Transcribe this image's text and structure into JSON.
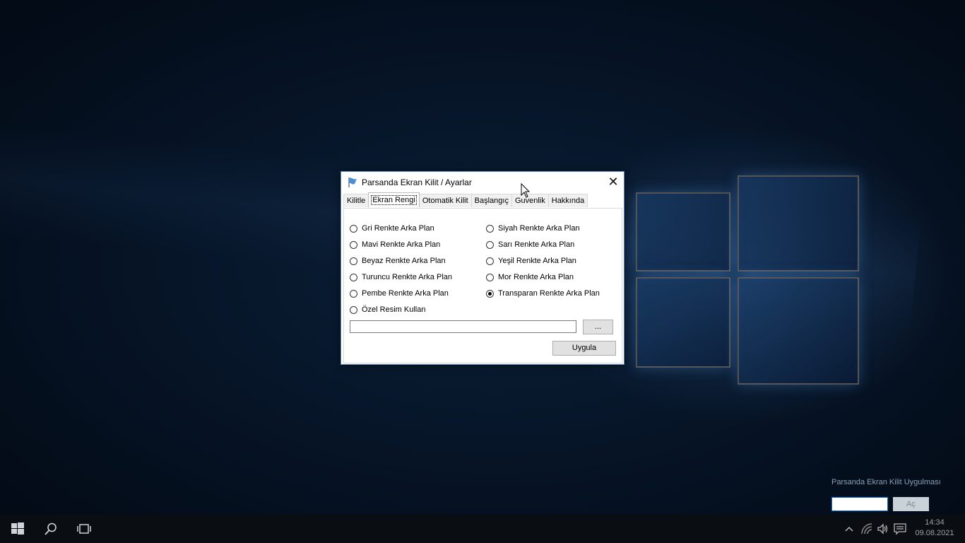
{
  "dialog": {
    "title": "Parsanda Ekran Kilit / Ayarlar",
    "close_symbol": "✕",
    "tabs": [
      {
        "label": "Kilitle"
      },
      {
        "label": "Ekran Rengi"
      },
      {
        "label": "Otomatik Kilit"
      },
      {
        "label": "Başlangıç"
      },
      {
        "label": "Guvenlik"
      },
      {
        "label": "Hakkında"
      }
    ],
    "active_tab": "Ekran Rengi",
    "options_left": [
      {
        "label": "Gri Renkte Arka Plan",
        "checked": false
      },
      {
        "label": "Mavi Renkte Arka Plan",
        "checked": false
      },
      {
        "label": "Beyaz Renkte Arka Plan",
        "checked": false
      },
      {
        "label": "Turuncu Renkte Arka Plan",
        "checked": false
      },
      {
        "label": "Pembe Renkte Arka Plan",
        "checked": false
      },
      {
        "label": "Özel Resim Kullan",
        "checked": false
      }
    ],
    "options_right": [
      {
        "label": "Siyah Renkte Arka Plan",
        "checked": false
      },
      {
        "label": "Sarı Renkte Arka Plan",
        "checked": false
      },
      {
        "label": "Yeşil Renkte Arka Plan",
        "checked": false
      },
      {
        "label": "Mor Renkte Arka Plan",
        "checked": false
      },
      {
        "label": "Transparan Renkte Arka Plan",
        "checked": true
      }
    ],
    "image_path": "",
    "browse_label": "...",
    "apply_label": "Uygula"
  },
  "lock_widget": {
    "label": "Parsanda Ekran Kilit Uygulması",
    "password_value": "",
    "open_label": "Aç"
  },
  "taskbar": {
    "time": "14:34",
    "date": "09.08.2021"
  },
  "colors": {
    "accent": "#0078d7",
    "dialog_border": "#5b86c4",
    "taskbar": "#0a0d12"
  }
}
